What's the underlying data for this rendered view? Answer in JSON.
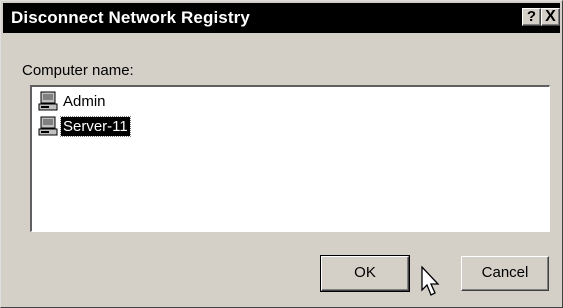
{
  "window": {
    "title": "Disconnect Network Registry",
    "help_label": "?",
    "close_label": "X"
  },
  "form": {
    "computer_name_label": "Computer name:",
    "items": [
      {
        "label": "Admin",
        "icon": "computer-icon",
        "selected": false
      },
      {
        "label": "Server-11",
        "icon": "computer-icon",
        "selected": true
      }
    ]
  },
  "buttons": {
    "ok_label": "OK",
    "cancel_label": "Cancel"
  },
  "colors": {
    "title_bar": "#000000",
    "dialog_face": "#d4d0c8",
    "selection": "#000000"
  }
}
